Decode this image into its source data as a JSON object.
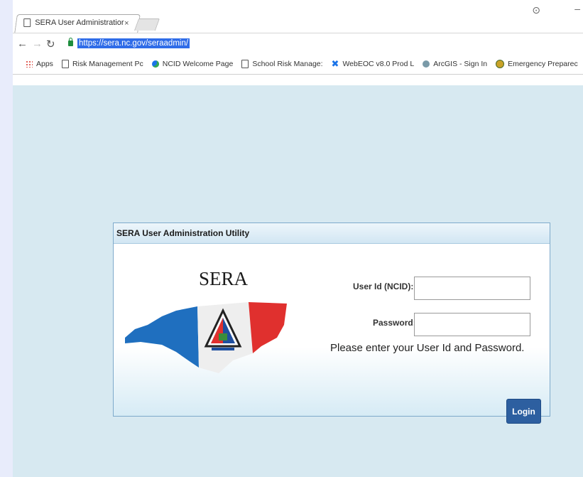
{
  "browser": {
    "tab_title": "SERA User Administratior",
    "tab_close": "×",
    "url": "https://sera.nc.gov/seraadmin/",
    "bookmarks": [
      {
        "label": "Apps",
        "icon": "apps-icon"
      },
      {
        "label": "Risk Management Pc",
        "icon": "page-icon"
      },
      {
        "label": "NCID Welcome Page",
        "icon": "globe-icon"
      },
      {
        "label": "School Risk Manage:",
        "icon": "page-icon"
      },
      {
        "label": "WebEOC v8.0 Prod L",
        "icon": "x-icon"
      },
      {
        "label": "ArcGIS - Sign In",
        "icon": "arc-icon"
      },
      {
        "label": "Emergency Preparec",
        "icon": "seal-icon"
      }
    ]
  },
  "dialog": {
    "title": "SERA User Administration Utility",
    "logo_text": "SERA",
    "user_id_label": "User Id (NCID):",
    "password_label": "Password:",
    "prompt": "Please enter your User Id and Password.",
    "login_label": "Login"
  },
  "colors": {
    "page_bg": "#d7e9f1",
    "accent": "#2d5fa0",
    "flag_blue": "#1f6fbf",
    "flag_red": "#e0302e"
  }
}
